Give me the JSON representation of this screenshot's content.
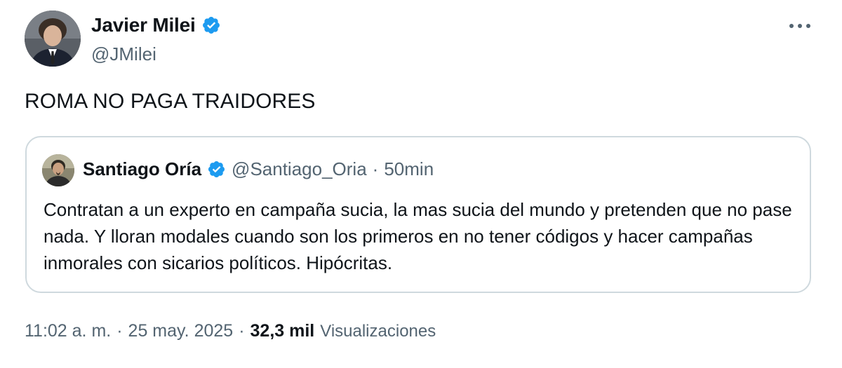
{
  "author": {
    "name": "Javier Milei",
    "handle": "@JMilei",
    "verified_color": "#1d9bf0"
  },
  "tweet": {
    "text": "ROMA NO PAGA TRAIDORES"
  },
  "quote": {
    "name": "Santiago Oría",
    "handle": "@Santiago_Oria",
    "separator": "·",
    "time": "50min",
    "text": "Contratan a un experto en campaña sucia, la mas sucia del mundo y pretenden que no pase nada. Y lloran modales cuando son los primeros en no tener códigos y hacer campañas inmorales con sicarios políticos. Hipócritas."
  },
  "meta": {
    "time": "11:02 a. m.",
    "separator1": "·",
    "date": "25 may. 2025",
    "separator2": "·",
    "views_count": "32,3 mil",
    "views_label": "Visualizaciones"
  },
  "icons": {
    "more": "more-horizontal-icon",
    "verified": "verified-badge-icon"
  },
  "colors": {
    "text_primary": "#0f1419",
    "text_secondary": "#536471",
    "border": "#cfd9de",
    "accent": "#1d9bf0"
  }
}
